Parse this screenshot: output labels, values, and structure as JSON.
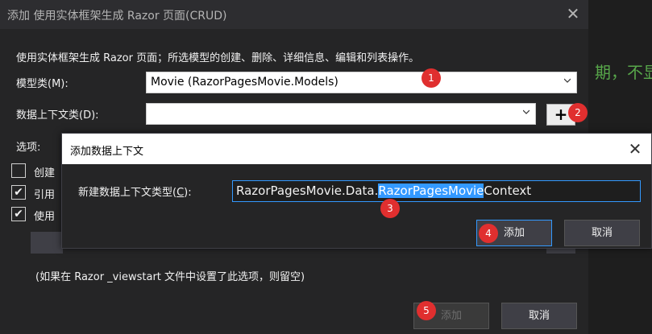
{
  "background": {
    "editor_text": "期，不显"
  },
  "main_dialog": {
    "title": "添加 使用实体框架生成 Razor 页面(CRUD)",
    "description": "使用实体框架生成 Razor 页面；所选模型的创建、删除、详细信息、编辑和列表操作。",
    "model_label": "模型类(M):",
    "model_value": "Movie (RazorPagesMovie.Models)",
    "context_label": "数据上下文类(D):",
    "context_value": "",
    "add_context_symbol": "+",
    "options_label": "选项:",
    "checkboxes": [
      {
        "label": "创建",
        "checked": false
      },
      {
        "label": "引用",
        "checked": true
      },
      {
        "label": "使用",
        "checked": true
      }
    ],
    "layout_hint": "(如果在 Razor _viewstart 文件中设置了此选项，则留空)",
    "add_button": "添加",
    "cancel_button": "取消"
  },
  "popup_dialog": {
    "title": "添加数据上下文",
    "type_label_prefix": "新建数据上下文类型(",
    "type_label_key": "C",
    "type_label_suffix": "):",
    "type_value_before": "RazorPagesMovie.Data.",
    "type_value_selected": "RazorPagesMovie",
    "type_value_after": "Context",
    "add_button": "添加",
    "cancel_button": "取消"
  },
  "markers": [
    "1",
    "2",
    "3",
    "4",
    "5"
  ],
  "colors": {
    "marker": "#e02f2f",
    "selection": "#3399ff",
    "dialog_bg": "#252526"
  }
}
